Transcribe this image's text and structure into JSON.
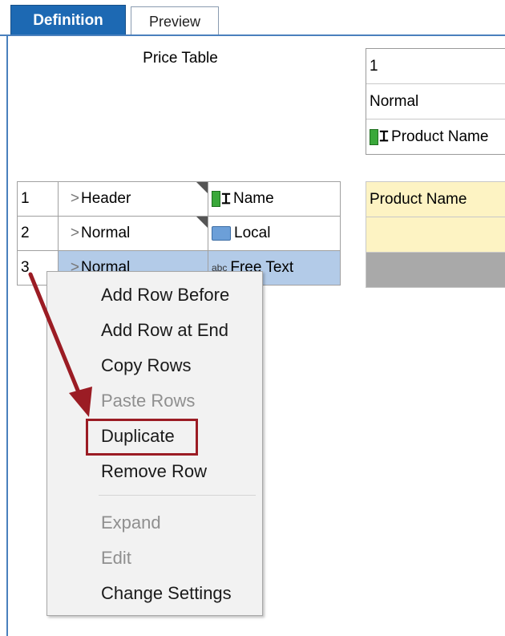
{
  "tabs": {
    "definition": "Definition",
    "preview": "Preview"
  },
  "table_title": "Price Table",
  "properties": {
    "number": "1",
    "style": "Normal",
    "field": "Product Name"
  },
  "grid_rows": [
    {
      "num": "1",
      "type": "Header",
      "field": "Name",
      "field_icon": "column-resize-icon"
    },
    {
      "num": "2",
      "type": "Normal",
      "field": "Local",
      "field_icon": "folder-db-icon"
    },
    {
      "num": "3",
      "type": "Normal",
      "field": "Free Text",
      "field_icon": "abc-text-icon"
    }
  ],
  "preview": {
    "row1": "Product Name"
  },
  "context_menu": {
    "add_row_before": "Add Row Before",
    "add_row_at_end": "Add Row at End",
    "copy_rows": "Copy Rows",
    "paste_rows": "Paste Rows",
    "duplicate": "Duplicate",
    "remove_row": "Remove Row",
    "expand": "Expand",
    "edit": "Edit",
    "change_settings": "Change Settings"
  },
  "colors": {
    "tab_active": "#1d69b3",
    "selection": "#b3cbe8",
    "preview_yellow": "#fdf3c3",
    "highlight": "#9b1c24"
  }
}
